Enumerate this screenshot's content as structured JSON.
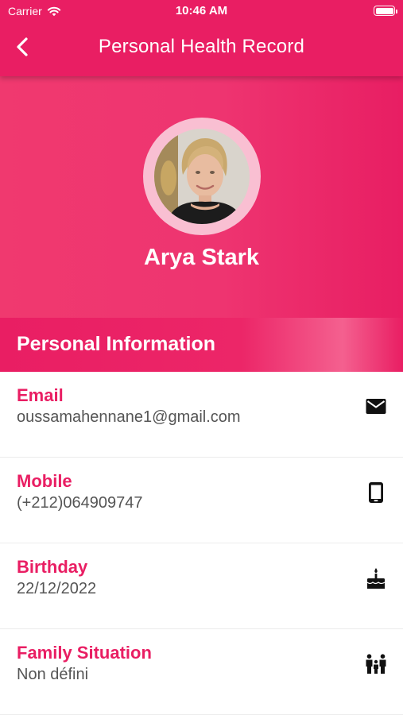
{
  "status_bar": {
    "carrier": "Carrier",
    "time": "10:46 AM"
  },
  "nav": {
    "title": "Personal Health Record",
    "back_icon": "chevron-left-icon"
  },
  "profile": {
    "name": "Arya Stark"
  },
  "section": {
    "title": "Personal Information"
  },
  "info": [
    {
      "label": "Email",
      "value": "oussamahennane1@gmail.com",
      "icon": "envelope-icon"
    },
    {
      "label": "Mobile",
      "value": "(+212)064909747",
      "icon": "smartphone-icon"
    },
    {
      "label": "Birthday",
      "value": "22/12/2022",
      "icon": "cake-icon"
    },
    {
      "label": "Family Situation",
      "value": "Non défini",
      "icon": "family-icon"
    }
  ],
  "colors": {
    "primary": "#e91e63",
    "avatar_ring": "#f9bfd2",
    "label": "#e91e63",
    "value": "#555555"
  }
}
